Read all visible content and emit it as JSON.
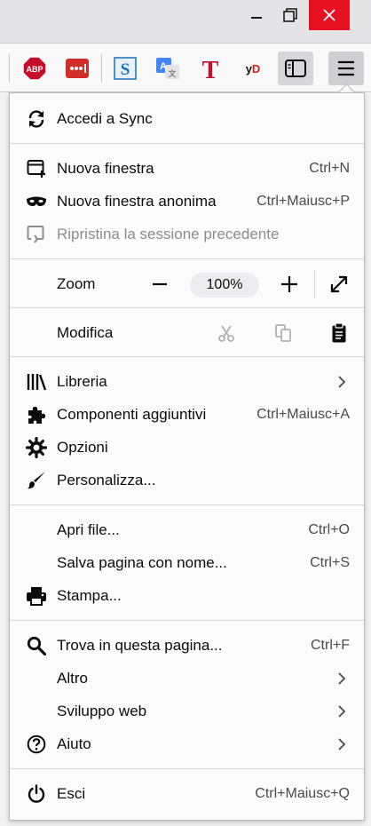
{
  "window": {
    "minimize_icon": "minimize-icon",
    "maximize_icon": "restore-icon",
    "close_icon": "close-icon",
    "close_color": "#e81123"
  },
  "toolbar": {
    "extensions": [
      {
        "name": "adblock-plus-icon",
        "text": "ABP",
        "color": "#c70d2c"
      },
      {
        "name": "lastpass-icon",
        "text": "•••",
        "color": "#d32d27"
      },
      {
        "name": "scribe-s-icon",
        "text": "S",
        "color": "#1b6fb8"
      },
      {
        "name": "translate-icon",
        "text": "A",
        "color": "#4285f4"
      },
      {
        "name": "font-t-icon",
        "text": "T",
        "color": "#c8102e"
      },
      {
        "name": "yandex-dictionary-icon",
        "text": "yD",
        "color": "#e21a1a"
      }
    ],
    "sidebar_icon": "sidebar-icon",
    "menu_icon": "hamburger-menu-icon"
  },
  "menu": {
    "sync": {
      "label": "Accedi a Sync",
      "icon": "sync-icon"
    },
    "new_window": {
      "label": "Nuova finestra",
      "shortcut": "Ctrl+N",
      "icon": "new-window-icon"
    },
    "private_window": {
      "label": "Nuova finestra anonima",
      "shortcut": "Ctrl+Maiusc+P",
      "icon": "private-mask-icon"
    },
    "restore_session": {
      "label": "Ripristina la sessione precedente",
      "icon": "restore-session-icon"
    },
    "zoom": {
      "label": "Zoom",
      "value": "100%",
      "minus": "−",
      "plus": "+",
      "fullscreen_icon": "fullscreen-icon"
    },
    "edit": {
      "label": "Modifica",
      "cut_icon": "cut-icon",
      "copy_icon": "copy-icon",
      "paste_icon": "paste-icon"
    },
    "library": {
      "label": "Libreria",
      "icon": "library-icon"
    },
    "addons": {
      "label": "Componenti aggiuntivi",
      "shortcut": "Ctrl+Maiusc+A",
      "icon": "puzzle-icon"
    },
    "options": {
      "label": "Opzioni",
      "icon": "gear-icon"
    },
    "customize": {
      "label": "Personalizza...",
      "icon": "paintbrush-icon"
    },
    "open_file": {
      "label": "Apri file...",
      "shortcut": "Ctrl+O"
    },
    "save_page": {
      "label": "Salva pagina con nome...",
      "shortcut": "Ctrl+S"
    },
    "print": {
      "label": "Stampa...",
      "icon": "printer-icon"
    },
    "find": {
      "label": "Trova in questa pagina...",
      "shortcut": "Ctrl+F",
      "icon": "search-icon"
    },
    "more": {
      "label": "Altro"
    },
    "web_dev": {
      "label": "Sviluppo web"
    },
    "help": {
      "label": "Aiuto",
      "icon": "help-icon"
    },
    "quit": {
      "label": "Esci",
      "shortcut": "Ctrl+Maiusc+Q",
      "icon": "power-icon"
    }
  }
}
